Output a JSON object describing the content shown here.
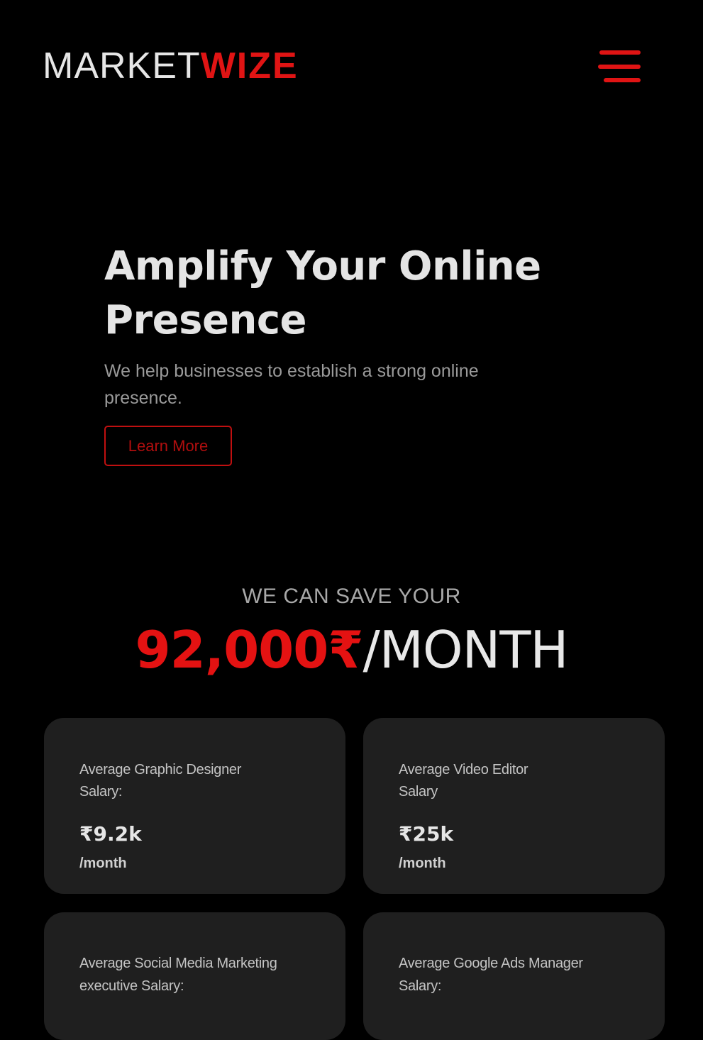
{
  "header": {
    "logo_part_a": "MARKET",
    "logo_part_b": "WIZE",
    "menu_icon": "hamburger-menu-icon"
  },
  "hero": {
    "title": "Amplify Your Online Presence",
    "subtitle": "We help businesses to establish a strong online presence.",
    "cta_label": "Learn More"
  },
  "savings": {
    "label": "WE CAN SAVE YOUR",
    "amount": "92,000₹",
    "period": "/MONTH"
  },
  "cards": [
    {
      "label": "Average Graphic Designer Salary:",
      "value": "₹9.2k",
      "unit": "/month"
    },
    {
      "label": "Average Video Editor Salary",
      "value": "₹25k",
      "unit": "/month"
    },
    {
      "label": "Average Social Media Marketing executive Salary:"
    },
    {
      "label": "Average Google Ads Manager Salary:"
    }
  ],
  "colors": {
    "background": "#000000",
    "accent": "#e01414",
    "card_background": "#1f1f1f",
    "text_primary": "#e6e6e6",
    "text_muted": "#9a9a9a"
  }
}
